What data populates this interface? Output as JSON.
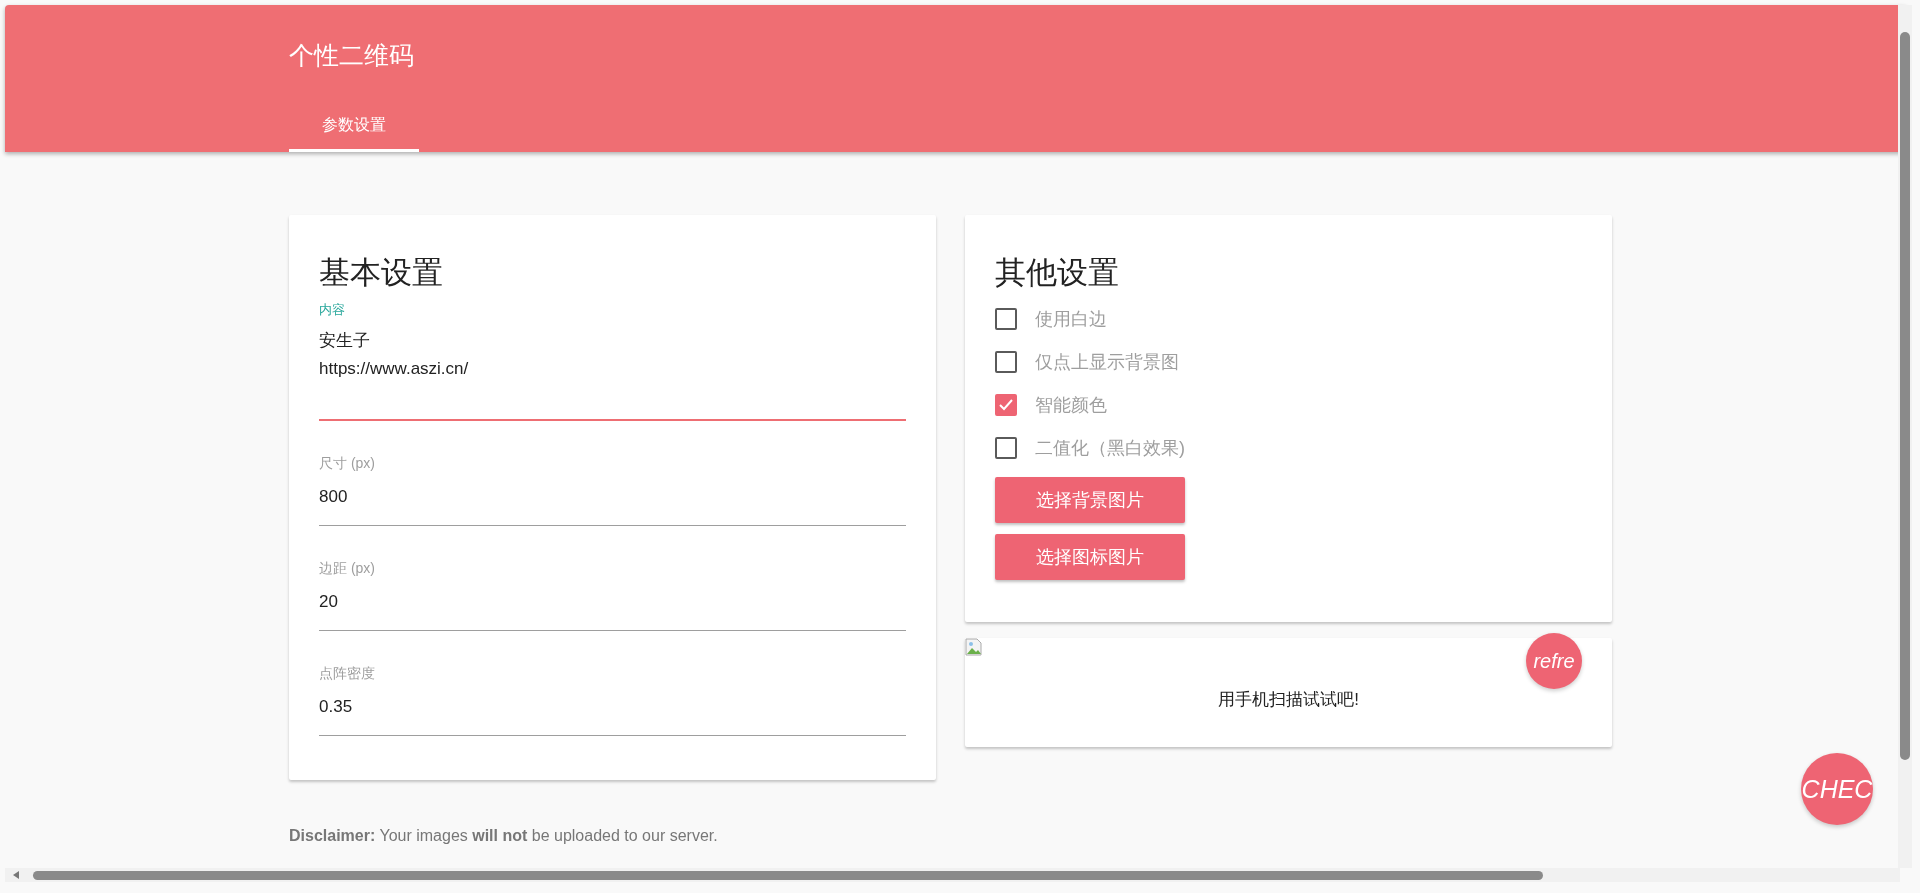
{
  "header": {
    "title": "个性二维码",
    "tabs": [
      {
        "label": "参数设置",
        "selected": true
      }
    ]
  },
  "basic": {
    "title": "基本设置",
    "fields": [
      {
        "label": "内容",
        "value": "安生子\nhttps://www.aszi.cn/",
        "focused": true
      },
      {
        "label": "尺寸 (px)",
        "value": "800",
        "focused": false
      },
      {
        "label": "边距 (px)",
        "value": "20",
        "focused": false
      },
      {
        "label": "点阵密度",
        "value": "0.35",
        "focused": false
      }
    ]
  },
  "other": {
    "title": "其他设置",
    "options": [
      {
        "label": "使用白边",
        "checked": false
      },
      {
        "label": "仅点上显示背景图",
        "checked": false
      },
      {
        "label": "智能颜色",
        "checked": true
      },
      {
        "label": "二值化（黑白效果)",
        "checked": false
      }
    ],
    "buttons": [
      "选择背景图片",
      "选择图标图片"
    ]
  },
  "preview": {
    "refresh_button": "refre",
    "caption": "用手机扫描试试吧!"
  },
  "check_button": "CHEC",
  "disclaimer": "**Disclaimer:** Your images **will not** be uploaded to our server."
}
